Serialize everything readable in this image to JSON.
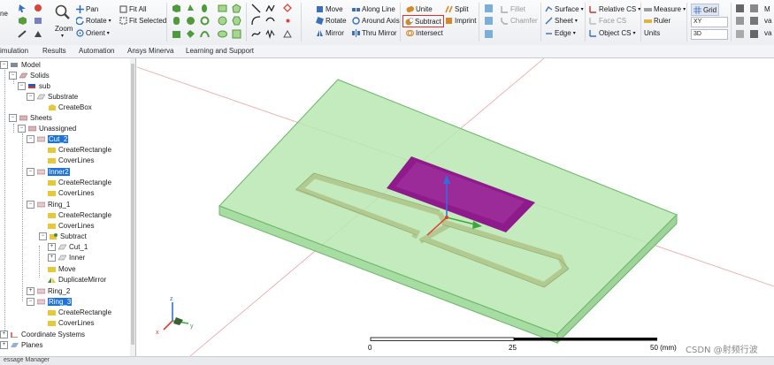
{
  "ribbon": {
    "fragment_left": "ne",
    "zoom": "Zoom",
    "pan": "Pan",
    "rotate": "Rotate",
    "orient": "Orient",
    "fit_all": "Fit All",
    "fit_selected": "Fit Selected",
    "move": "Move",
    "rotate2": "Rotate",
    "mirror": "Mirror",
    "along_line": "Along Line",
    "around_axis": "Around Axis",
    "thru_mirror": "Thru Mirror",
    "unite": "Unite",
    "subtract": "Subtract",
    "intersect": "Intersect",
    "split": "Split",
    "imprint": "Imprint",
    "fillet": "Fillet",
    "chamfer": "Chamfer",
    "surface": "Surface",
    "sheet": "Sheet",
    "edge": "Edge",
    "relative_cs": "Relative CS",
    "face_cs": "Face CS",
    "object_cs": "Object CS",
    "measure": "Measure",
    "ruler": "Ruler",
    "units": "Units",
    "grid": "Grid",
    "grid_plane": "XY",
    "grid_mode": "3D",
    "frag_m": "M",
    "frag_va": "va",
    "frag_va2": "va"
  },
  "tabs": [
    "imulation",
    "Results",
    "Automation",
    "Ansys Minerva",
    "Learning and Support"
  ],
  "tree": {
    "model": "Model",
    "solids": "Solids",
    "sub": "sub",
    "substrate": "Substrate",
    "createbox": "CreateBox",
    "sheets": "Sheets",
    "unassigned": "Unassigned",
    "cut2": "Cut_2",
    "createrect1": "CreateRectangle",
    "coverlines1": "CoverLines",
    "inner2": "Inner2",
    "createrect2": "CreateRectangle",
    "coverlines2": "CoverLines",
    "ring1": "Ring_1",
    "createrect3": "CreateRectangle",
    "coverlines3": "CoverLines",
    "subtract": "Subtract",
    "cut1": "Cut_1",
    "inner": "Inner",
    "move": "Move",
    "duplicatemirror": "DuplicateMirror",
    "ring2": "Ring_2",
    "ring3": "Ring_3",
    "createrect4": "CreateRectangle",
    "coverlines4": "CoverLines",
    "coordsys": "Coordinate Systems",
    "planes": "Planes"
  },
  "viewport": {
    "scale_0": "0",
    "scale_25": "25",
    "scale_50": "50 (mm)",
    "axis_x": "x",
    "axis_y": "y",
    "axis_z": "z",
    "watermark": "CSDN @射频行波"
  },
  "status": {
    "partial": "essage Manager"
  },
  "colors": {
    "substrate": "#b4e7b0",
    "patch": "#8e1a8c",
    "highlight": "#1e74d6",
    "selected_border": "#e0322b"
  }
}
